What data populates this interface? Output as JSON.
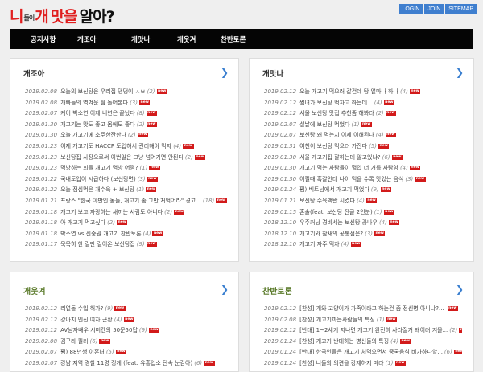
{
  "site": {
    "logo": {
      "part1": "니",
      "small": "들이",
      "part2": "개",
      "part3": "맛을",
      "part4": "알아?"
    },
    "buttons": [
      "LOGIN",
      "JOIN",
      "SITEMAP"
    ]
  },
  "nav": [
    "공지사항",
    "개조아",
    "개맛나",
    "개웃겨",
    "찬반토론"
  ],
  "panels": [
    {
      "title": "개조아",
      "rows": [
        {
          "date": "2019.02.08",
          "title": "오늘의 보신탕은 우리집 댕댕이 ㅅㅂ",
          "count": "(2)"
        },
        {
          "date": "2019.02.08",
          "title": "개빠들의 역겨운 짬 돌어본다",
          "count": "(3)"
        },
        {
          "date": "2019.02.07",
          "title": "케어 박소연 이제 니년은 끝났다",
          "count": "(8)"
        },
        {
          "date": "2019.01.30",
          "title": "개고기는 맛도 좋고 몸에도 좋다",
          "count": "(2)"
        },
        {
          "date": "2019.01.30",
          "title": "오늘 개고기에 소주한잔한다",
          "count": "(2)"
        },
        {
          "date": "2019.01.23",
          "title": "이제 개고기도 HACCP 도입해서 관리해야 먹자",
          "count": "(4)"
        },
        {
          "date": "2019.01.23",
          "title": "보신탕집 사장으로써 이번일은 그냥 넘어가면 안된다",
          "count": "(2)"
        },
        {
          "date": "2019.01.23",
          "title": "먹방하는 회들 개고기 먹방 어떰?",
          "count": "(1)"
        },
        {
          "date": "2019.01.22",
          "title": "국내도입이 시급하다 (보신탕면)",
          "count": "(3)"
        },
        {
          "date": "2019.01.22",
          "title": "오늘 점심먹은 개수육 + 보신탕",
          "count": "(1)"
        },
        {
          "date": "2019.01.21",
          "title": "프랑스 \"한국 야만인 놈들, 개고기 좀 그만 처먹어라\" 경고...",
          "count": "(18)"
        },
        {
          "date": "2019.01.18",
          "title": "개고기 보고 자랑하는 새끼는 사람도 아니다",
          "count": "(2)"
        },
        {
          "date": "2019.01.18",
          "title": "아 개고기 먹고싶다",
          "count": "(2)"
        },
        {
          "date": "2019.01.18",
          "title": "박소연 vs 진중권 개고기 찬반토론",
          "count": "(4)"
        },
        {
          "date": "2019.01.17",
          "title": "묵묵히 한 길만 걸어온 보신탕집",
          "count": "(9)"
        }
      ]
    },
    {
      "title": "개맛나",
      "rows": [
        {
          "date": "2019.02.12",
          "title": "오늘 개고기 먹으러 갈건데 탕 얼마나 하나",
          "count": "(4)"
        },
        {
          "date": "2019.02.12",
          "title": "썸녀가 보신탕 먹자고 하는데...",
          "count": "(4)"
        },
        {
          "date": "2019.02.12",
          "title": "서울 보신탕 맛집 추천좀 해봐라",
          "count": "(2)"
        },
        {
          "date": "2019.02.07",
          "title": "설날에 보신탕 먹었다",
          "count": "(1)"
        },
        {
          "date": "2019.02.07",
          "title": "보신탕 왜 먹는지 이제 이해된다",
          "count": "(4)"
        },
        {
          "date": "2019.01.31",
          "title": "여친이 보신탕 먹으러 가잔다",
          "count": "(5)"
        },
        {
          "date": "2019.01.30",
          "title": "서울 개고기집 잘하는데 알고있냐?",
          "count": "(6)"
        },
        {
          "date": "2019.01.30",
          "title": "개고기 먹는 사람들이 혈압 더 거를 사람함",
          "count": "(4)"
        },
        {
          "date": "2019.01.30",
          "title": "어릴때 흑갈인데 나이 먹을 수록 맛있는 음식",
          "count": "(3)"
        },
        {
          "date": "2019.01.24",
          "title": "펌) 베트남에서 개고기 먹었다",
          "count": "(9)"
        },
        {
          "date": "2019.01.21",
          "title": "보신탕 수육백반 시켰다",
          "count": "(4)"
        },
        {
          "date": "2019.01.15",
          "title": "혼술(feat. 보신탕 전골 2인분)",
          "count": "(1)"
        },
        {
          "date": "2018.12.10",
          "title": "우주커닝 경비서는 보신탕 끊나우",
          "count": "(4)"
        },
        {
          "date": "2018.12.10",
          "title": "개고기와 참새의 공통점은?",
          "count": "(3)"
        },
        {
          "date": "2018.12.10",
          "title": "개고기 자주 먹자",
          "count": "(4)"
        }
      ]
    },
    {
      "title": "개웃겨",
      "rows": [
        {
          "date": "2019.02.12",
          "title": "리얼돌 수입 허가?",
          "count": "(9)"
        },
        {
          "date": "2019.02.12",
          "title": "강아지 엔진 여자 근황",
          "count": "(4)"
        },
        {
          "date": "2019.02.12",
          "title": "AV남자배우 시미켄의 50문50답",
          "count": "(9)"
        },
        {
          "date": "2019.02.08",
          "title": "김구라 킬러",
          "count": "(6)"
        },
        {
          "date": "2019.02.07",
          "title": "펌) 88년생 이혼녀",
          "count": "(5)"
        },
        {
          "date": "2019.02.07",
          "title": "강남 지역 경찰 11명 징계 (feat. 유흥업소 단속 눈감아)",
          "count": "(6)"
        }
      ]
    },
    {
      "title": "찬반토론",
      "rows": [
        {
          "date": "2019.02.12",
          "title": "[찬성] 개와 고양이가 가족이라고 하는건 좀 정신병 아니냐?...",
          "count": ""
        },
        {
          "date": "2019.02.08",
          "title": "[찬성] 개고기까는사람들의 특징",
          "count": "(1)"
        },
        {
          "date": "2019.02.12",
          "title": "[반대] 1~2세기 지나면 개고기 완전히 사라질거 왜이러 겨울...",
          "count": "(2)"
        },
        {
          "date": "2019.01.24",
          "title": "[찬성] 개고기 반대하는 병신들의 특징",
          "count": "(4)"
        },
        {
          "date": "2019.01.24",
          "title": "[반대] 한국인들은 개고기 처먹으면서 중국음식 비가하다할...",
          "count": "(6)"
        },
        {
          "date": "2019.01.24",
          "title": "[찬성] 니들의 의견을 강제하지 마라",
          "count": "(1)"
        }
      ]
    }
  ],
  "badge_text": "new",
  "colors": {
    "accent": "#3f7fcf",
    "badge": "#d21a1a",
    "nav_bg": "#050505"
  }
}
